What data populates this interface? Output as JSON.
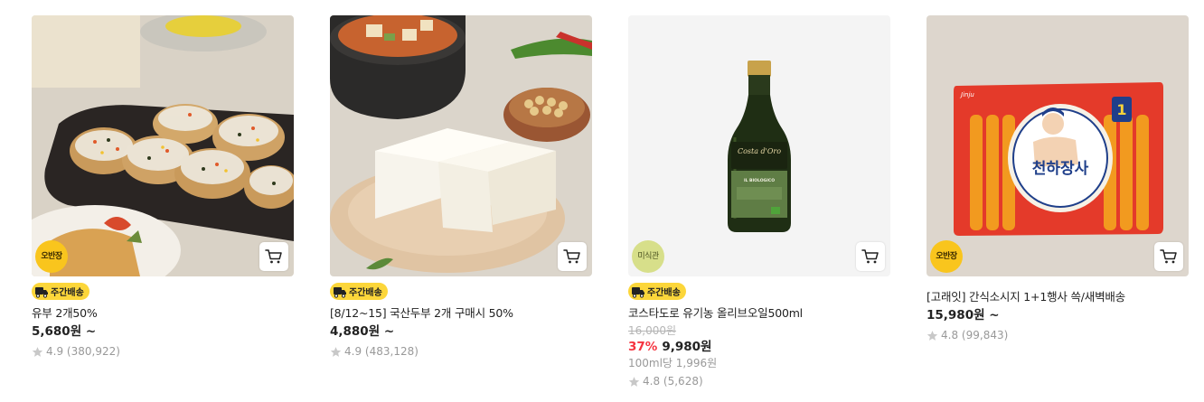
{
  "products": [
    {
      "image_alt": "유부 초밥",
      "round_badge": "오반장",
      "delivery_badge": "주간배송",
      "name": "유부 2개50%",
      "original_price": "",
      "discount": "",
      "price": "5,680원 ~",
      "unit_price": "",
      "rating": "4.9",
      "review_count": "(380,922)"
    },
    {
      "image_alt": "두부",
      "round_badge": "",
      "delivery_badge": "주간배송",
      "name": "[8/12~15] 국산두부 2개 구매시 50%",
      "original_price": "",
      "discount": "",
      "price": "4,880원 ~",
      "unit_price": "",
      "rating": "4.9",
      "review_count": "(483,128)"
    },
    {
      "image_alt": "올리브오일",
      "round_badge": "미식관",
      "delivery_badge": "주간배송",
      "name": "코스타도로 유기농 올리브오일500ml",
      "original_price": "16,000원",
      "discount": "37%",
      "price": "9,980원",
      "unit_price": "100ml당 1,996원",
      "rating": "4.8",
      "review_count": "(5,628)"
    },
    {
      "image_alt": "천하장사 소시지",
      "round_badge": "오반장",
      "delivery_badge": "",
      "name": "[고래잇] 간식소시지 1+1행사 쓱/새벽배송",
      "original_price": "",
      "discount": "",
      "price": "15,980원 ~",
      "unit_price": "",
      "rating": "4.8",
      "review_count": "(99,843)"
    }
  ],
  "artwork_text": {
    "olive_brand": "Costa d'Oro",
    "olive_label": "IL BIOLOGICO",
    "sausage_brand": "Jinju",
    "sausage_title": "천하장사",
    "sausage_rank": "1"
  },
  "icons": {
    "cart": "cart-icon",
    "star": "star-icon",
    "truck": "truck-icon"
  },
  "colors": {
    "delivery_badge": "#fcd63a",
    "round_badge_yellow": "#f9c51d",
    "round_badge_green": "#d7df8a",
    "discount": "#f5333f",
    "star": "#c8c8c8"
  }
}
